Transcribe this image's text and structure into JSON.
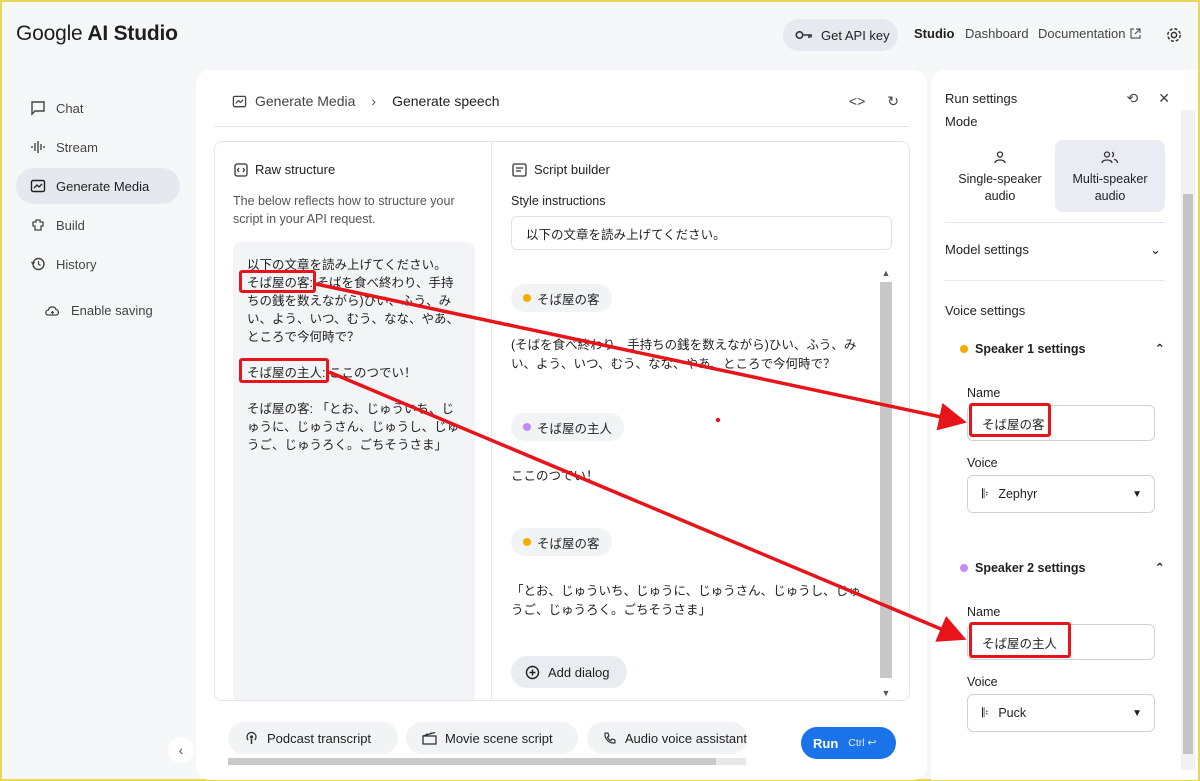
{
  "app": {
    "logo_part1": "Google",
    "logo_part2": " AI Studio"
  },
  "header": {
    "get_api_key": "Get API key",
    "nav_studio": "Studio",
    "nav_dashboard": "Dashboard",
    "nav_documentation": "Documentation"
  },
  "sidebar": {
    "items": [
      {
        "label": "Chat",
        "icon": "chat-icon"
      },
      {
        "label": "Stream",
        "icon": "stream-icon"
      },
      {
        "label": "Generate Media",
        "icon": "media-icon"
      },
      {
        "label": "Build",
        "icon": "build-icon"
      },
      {
        "label": "History",
        "icon": "history-icon"
      }
    ],
    "enable_saving": "Enable saving"
  },
  "breadcrumb": {
    "parent": "Generate Media",
    "current": "Generate speech"
  },
  "raw": {
    "title": "Raw structure",
    "description": "The below reflects how to structure your script in your API request.",
    "content": "以下の文章を読み上げてください。\nそば屋の客: そばを食べ終わり、手持ちの銭を数えながら)ひい、ふう、みい、よう、いつ、むう、なな、やあ、ところで今何時で？\n\nそば屋の主人: ここのつでい！\n\nそば屋の客: 「とお、じゅういち、じゅうに、じゅうさん、じゅうし、じゅうご、じゅうろく。ごちそうさま」"
  },
  "script": {
    "title": "Script builder",
    "style_label": "Style instructions",
    "style_value": "以下の文章を読み上げてください。",
    "dialogs": [
      {
        "speaker": "そば屋の客",
        "color": "#f9ab00",
        "text": "(そばを食べ終わり、手持ちの銭を数えながら)ひい、ふう、みい、よう、いつ、むう、なな、やあ、ところで今何時で？"
      },
      {
        "speaker": "そば屋の主人",
        "color": "#c58af9",
        "text": "ここのつでい！"
      },
      {
        "speaker": "そば屋の客",
        "color": "#f9ab00",
        "text": "「とお、じゅういち、じゅうに、じゅうさん、じゅうし、じゅうご、じゅうろく。ごちそうさま」"
      }
    ],
    "add_dialog": "Add dialog"
  },
  "suggestions": [
    "Podcast transcript",
    "Movie scene script",
    "Audio voice assistant"
  ],
  "run": {
    "label": "Run",
    "shortcut": "Ctrl ↩"
  },
  "settings": {
    "title": "Run settings",
    "mode_label": "Mode",
    "mode_single_line1": "Single-speaker",
    "mode_single_line2": "audio",
    "mode_multi_line1": "Multi-speaker",
    "mode_multi_line2": "audio",
    "model_settings": "Model settings",
    "voice_settings": "Voice settings",
    "speakers": [
      {
        "heading": "Speaker 1 settings",
        "color": "#f9ab00",
        "name_label": "Name",
        "name_value": "そば屋の客",
        "voice_label": "Voice",
        "voice_value": "Zephyr"
      },
      {
        "heading": "Speaker 2 settings",
        "color": "#c58af9",
        "name_label": "Name",
        "name_value": "そば屋の主人",
        "voice_label": "Voice",
        "voice_value": "Puck"
      }
    ]
  },
  "colors": {
    "accent": "#1a73e8",
    "annotation": "#e8141b"
  }
}
